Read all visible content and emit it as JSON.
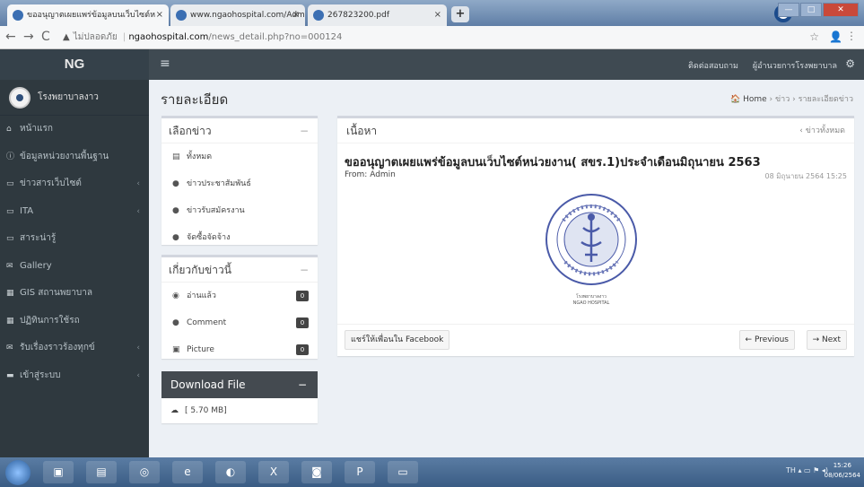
{
  "browser": {
    "tabs": [
      {
        "label": "ขออนุญาตเผยแพร่ข้อมูลบนเว็บไซต์ห",
        "active": true
      },
      {
        "label": "www.ngaohospital.com/Admin/",
        "active": false
      },
      {
        "label": "267823200.pdf",
        "active": false
      }
    ],
    "new_tab": "+",
    "address": {
      "insecure_label": "ไม่ปลอดภัย",
      "host": "ngaohospital.com",
      "path": "/news_detail.php?no=000124"
    }
  },
  "header": {
    "logo": "NG",
    "menu_icon": "≡",
    "links": [
      "ติดต่อสอบถาม",
      "ผู้อำนวยการโรงพยาบาล"
    ],
    "settings_icon": "gears-icon"
  },
  "sidebar": {
    "user_name": "โรงพยาบาลงาว",
    "items": [
      {
        "label": "หน้าแรก",
        "icon": "home-icon",
        "has_arrow": false
      },
      {
        "label": "ข้อมูลหน่วยงานพื้นฐาน",
        "icon": "info-icon",
        "has_arrow": false
      },
      {
        "label": "ข่าวสารเว็บไซต์",
        "icon": "monitor-icon",
        "has_arrow": true
      },
      {
        "label": "ITA",
        "icon": "monitor-icon",
        "has_arrow": true
      },
      {
        "label": "สาระน่ารู้",
        "icon": "monitor-icon",
        "has_arrow": false
      },
      {
        "label": "Gallery",
        "icon": "envelope-icon",
        "has_arrow": false
      },
      {
        "label": "GIS สถานพยาบาล",
        "icon": "table-icon",
        "has_arrow": false
      },
      {
        "label": "ปฏิทินการใช้รถ",
        "icon": "calendar-icon",
        "has_arrow": false
      },
      {
        "label": "รับเรื่องราวร้องทุกข์",
        "icon": "envelope-icon",
        "has_arrow": true
      },
      {
        "label": "เข้าสู่ระบบ",
        "icon": "folder-icon",
        "has_arrow": true
      }
    ]
  },
  "page": {
    "title": "รายละเอียด",
    "breadcrumb": [
      "Home",
      "ข่าว",
      "รายละเอียดข่าว"
    ]
  },
  "select_news": {
    "title": "เลือกข่าว",
    "items": [
      "ทั้งหมด",
      "ข่าวประชาสัมพันธ์",
      "ข่าวรับสมัครงาน",
      "จัดซื้อจัดจ้าง"
    ]
  },
  "about_news": {
    "title": "เกี่ยวกับข่าวนี้",
    "items": [
      {
        "label": "อ่านแล้ว",
        "count": "0"
      },
      {
        "label": "Comment",
        "count": "0"
      },
      {
        "label": "Picture",
        "count": "0"
      }
    ]
  },
  "download": {
    "title": "Download File",
    "file": "[ 5.70 MB]"
  },
  "content": {
    "title": "เนื้อหา",
    "back_link": "ข่าวทั้งหมด",
    "news_title": "ขออนุญาตเผยแพร่ข้อมูลบนเว็บไซต์หน่วยงาน( สขร.1)ประจำเดือนมิถุนายน 2563",
    "from": "From: Admin",
    "date": "08 มิถุนายน 2564 15:25",
    "seal_caption": [
      "โรงพยาบาลงาว",
      "NGAO HOSPITAL"
    ],
    "share_button": "แชร์ให้เพื่อนใน Facebook",
    "prev_button": "Previous",
    "next_button": "Next"
  },
  "taskbar": {
    "tray": "TH",
    "time": "15:26",
    "date": "08/06/2564"
  }
}
